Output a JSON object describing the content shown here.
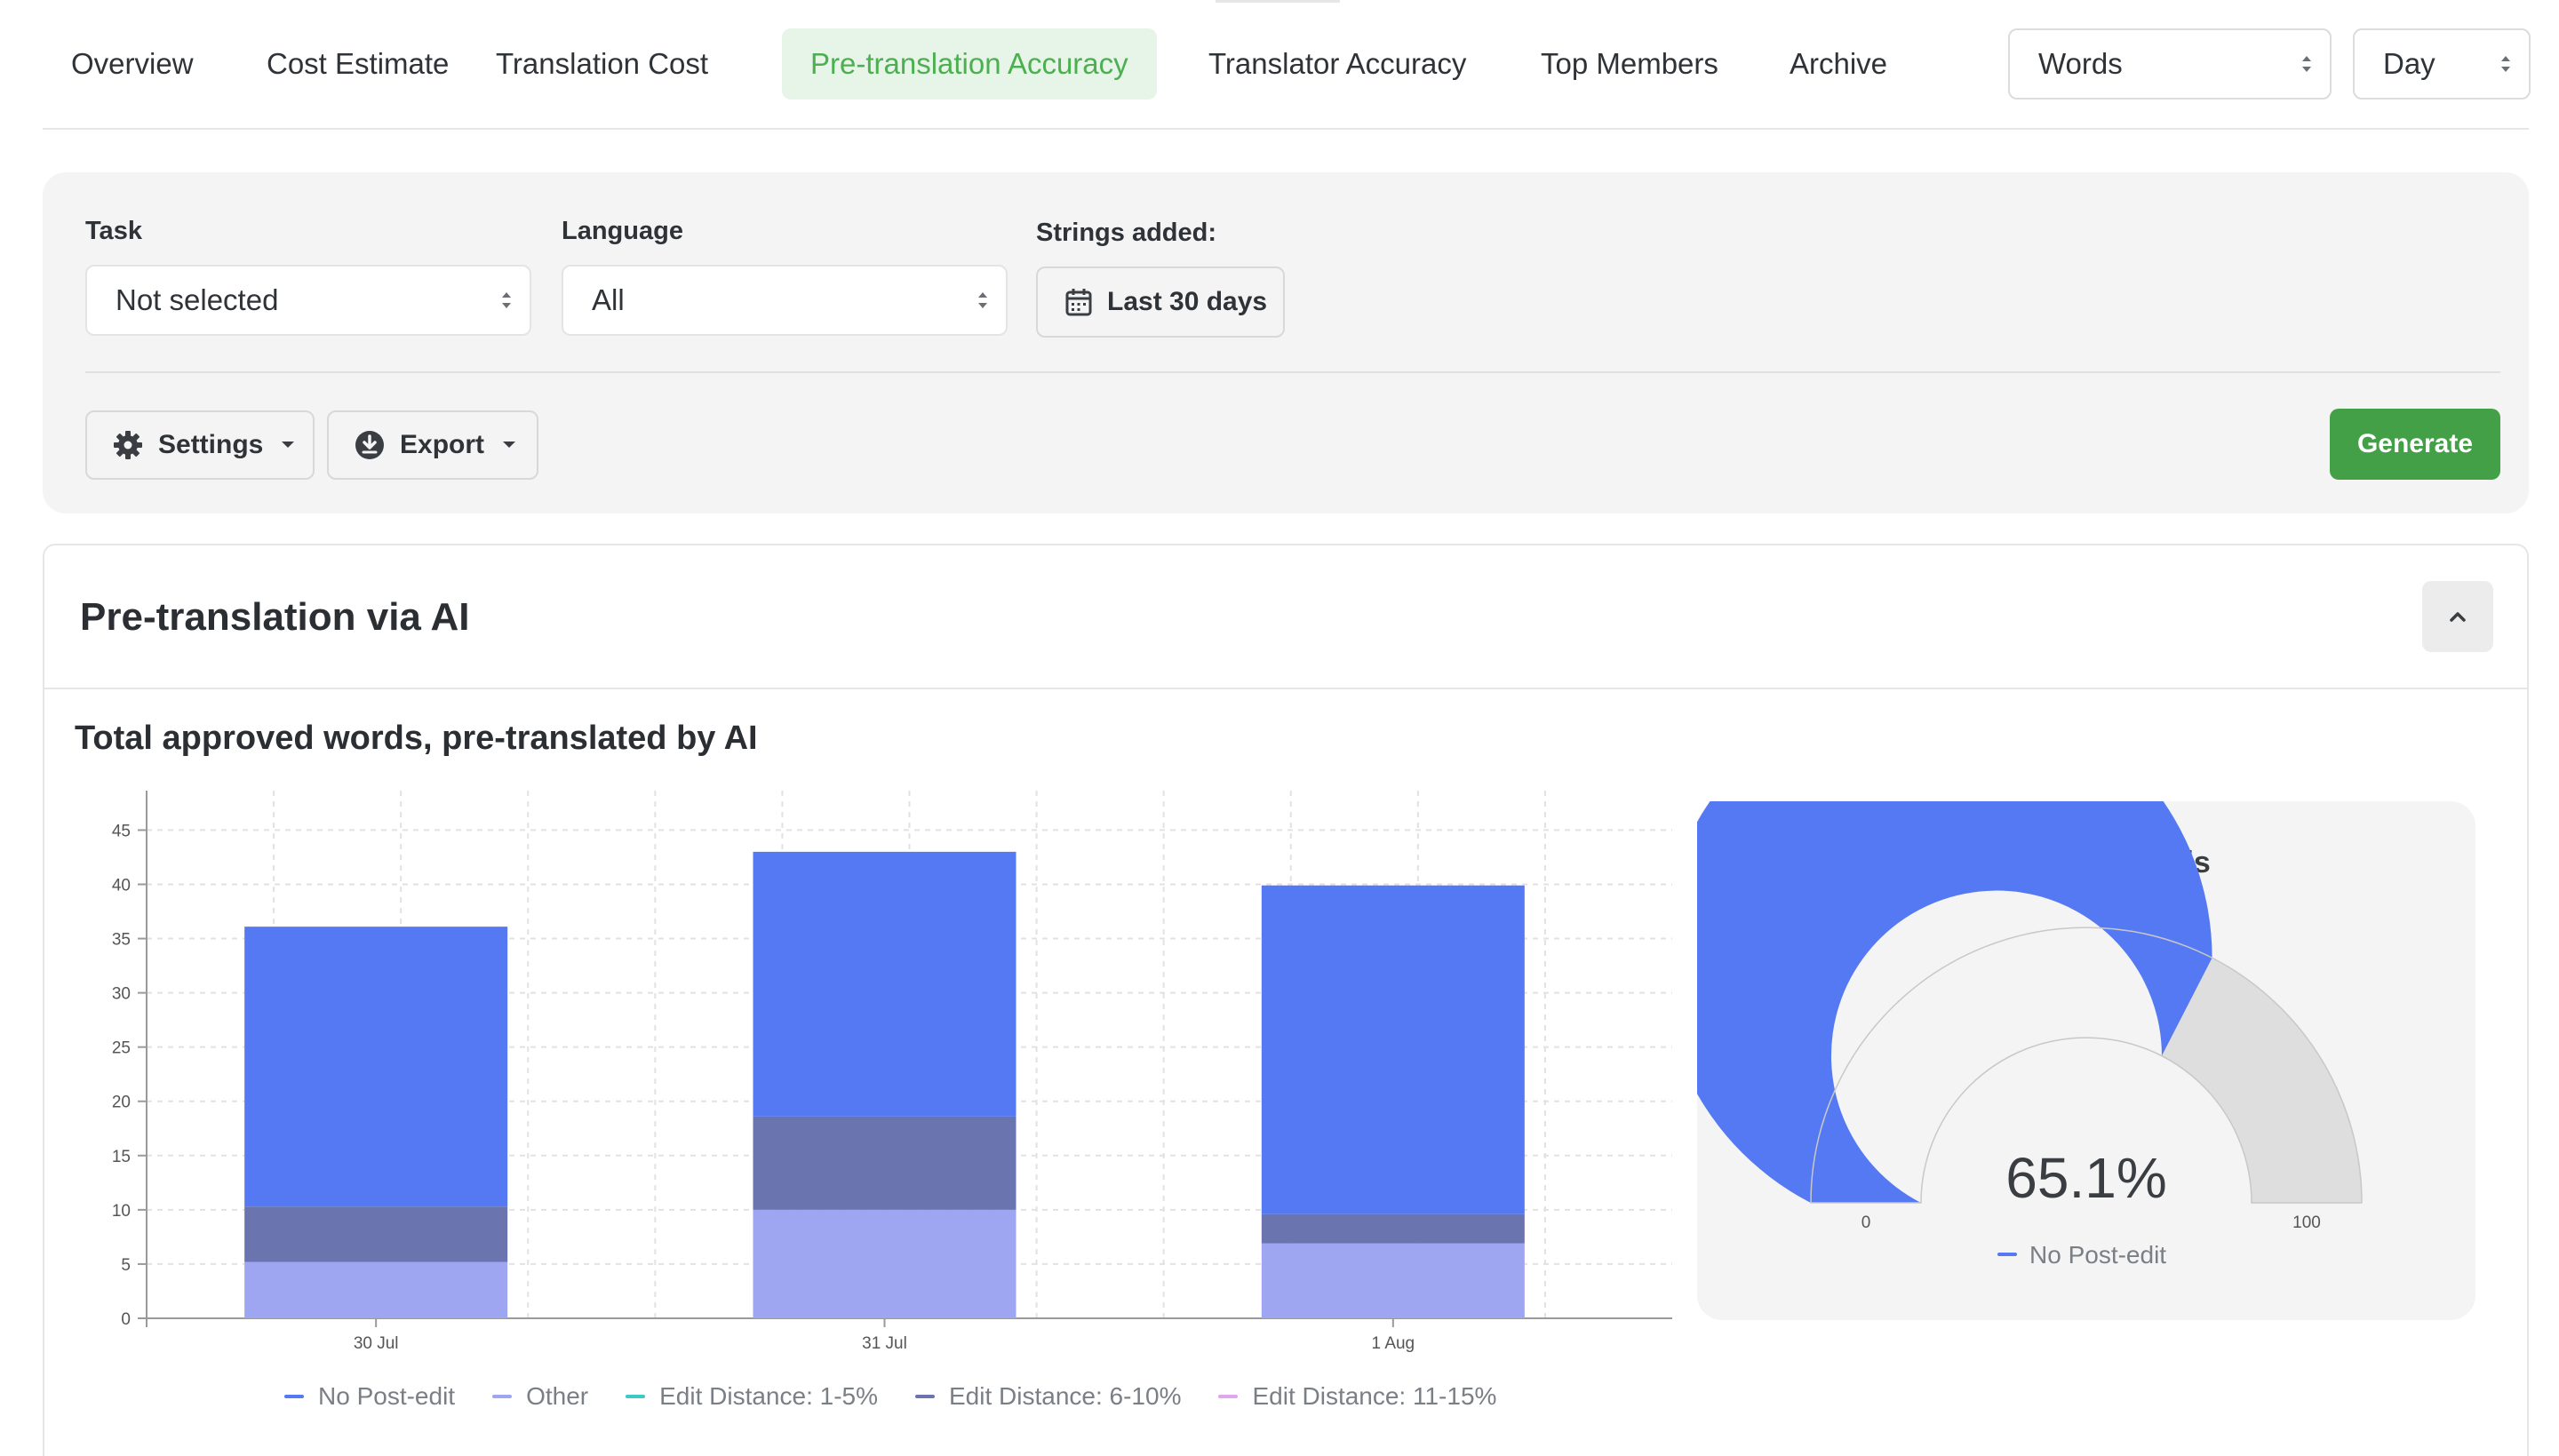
{
  "tabs": [
    {
      "label": "Overview",
      "active": false
    },
    {
      "label": "Cost Estimate",
      "active": false
    },
    {
      "label": "Translation Cost",
      "active": false
    },
    {
      "label": "Pre-translation Accuracy",
      "active": true
    },
    {
      "label": "Translator Accuracy",
      "active": false
    },
    {
      "label": "Top Members",
      "active": false
    },
    {
      "label": "Archive",
      "active": false
    }
  ],
  "unit_select": {
    "value": "Words"
  },
  "period_select": {
    "value": "Day"
  },
  "filters": {
    "task": {
      "label": "Task",
      "value": "Not selected"
    },
    "language": {
      "label": "Language",
      "value": "All"
    },
    "strings_added": {
      "label": "Strings added:",
      "value": "Last 30 days"
    },
    "settings_label": "Settings",
    "export_label": "Export",
    "generate_label": "Generate"
  },
  "card": {
    "title": "Pre-translation via AI",
    "section_title": "Total approved words, pre-translated by AI"
  },
  "colors": {
    "accent_green": "#43a047",
    "no_post_edit": "#5479f3",
    "other": "#9ea5f1",
    "edit_1_5": "#3ec9c5",
    "edit_6_10": "#6a74ae",
    "edit_11_15": "#e2a4ec",
    "gauge_rest": "#dedede"
  },
  "chart_data": [
    {
      "type": "bar",
      "stacked": true,
      "categories": [
        "30 Jul",
        "31 Jul",
        "1 Aug"
      ],
      "series": [
        {
          "name": "Other",
          "color": "#9ea5f1",
          "values": [
            5.2,
            10,
            6.9
          ]
        },
        {
          "name": "Edit Distance: 6-10%",
          "color": "#6a74ae",
          "values": [
            5.1,
            8.6,
            2.7
          ]
        },
        {
          "name": "No Post-edit",
          "color": "#5479f3",
          "values": [
            25.8,
            24.4,
            30.3
          ]
        }
      ],
      "legend": [
        {
          "name": "No Post-edit",
          "color": "#5479f3"
        },
        {
          "name": "Other",
          "color": "#9ea5f1"
        },
        {
          "name": "Edit Distance: 1-5%",
          "color": "#3ec9c5"
        },
        {
          "name": "Edit Distance: 6-10%",
          "color": "#6a74ae"
        },
        {
          "name": "Edit Distance: 11-15%",
          "color": "#e2a4ec"
        }
      ],
      "yticks": [
        0,
        5,
        10,
        15,
        20,
        25,
        30,
        35,
        40,
        45
      ],
      "ylim": [
        0,
        47
      ],
      "grid": true,
      "legend_position": "bottom"
    },
    {
      "type": "gauge",
      "title": "Amount of words",
      "value": 65.1,
      "value_label": "65.1%",
      "min_label": "0",
      "max_label": "100",
      "range": [
        0,
        100
      ],
      "series_name": "No Post-edit",
      "color": "#5479f3",
      "rest_color": "#dedede"
    }
  ]
}
